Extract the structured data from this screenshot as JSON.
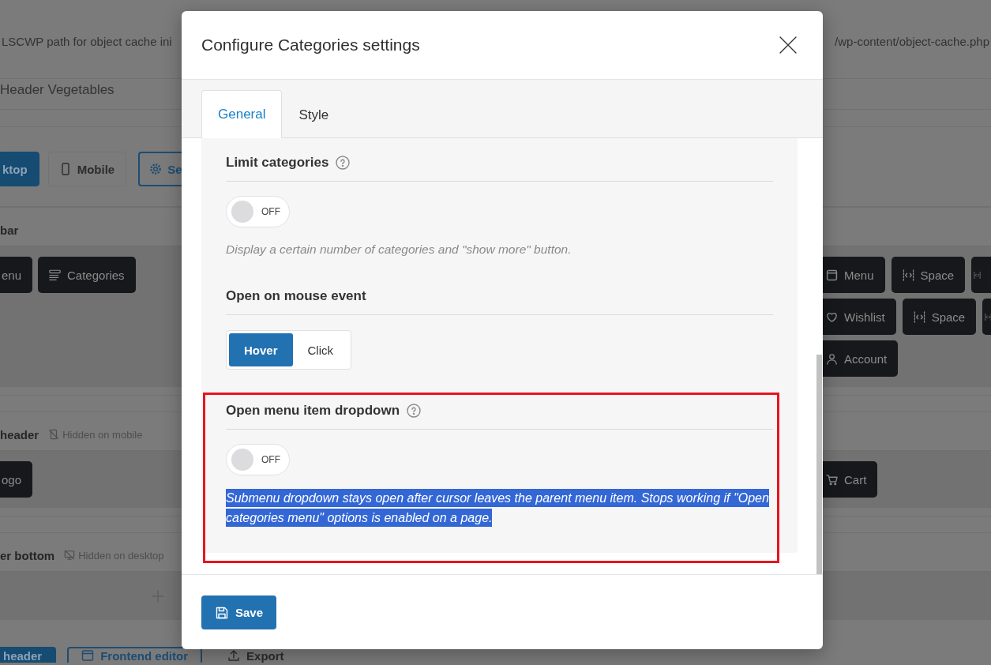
{
  "background": {
    "object_cache_row": {
      "label": "LSCWP path for object cache ini",
      "value": "/wp-content/object-cache.php"
    },
    "header_name": "Header Vegetables",
    "device_tabs": [
      {
        "label": "ktop",
        "selected": true
      },
      {
        "label": "Mobile",
        "selected": false,
        "kind": "mobile"
      }
    ],
    "settings_button": "Se",
    "builder_rows": [
      {
        "title": "bar",
        "left_elements": [
          {
            "label": "enu"
          },
          {
            "kind": "categories",
            "label": "Categories"
          }
        ],
        "right_groups": [
          {
            "elements": [
              {
                "kind": "menu",
                "label": "Menu"
              },
              {
                "kind": "space",
                "label": "Space"
              },
              {
                "kind": "space"
              }
            ]
          },
          {
            "elements": [
              {
                "kind": "wishlist",
                "label": "Wishlist"
              },
              {
                "kind": "space",
                "label": "Space"
              },
              {
                "kind": "space"
              }
            ]
          },
          {
            "elements": [
              {
                "kind": "account",
                "label": "Account"
              }
            ]
          }
        ]
      },
      {
        "title": "header",
        "visibility": {
          "kind": "mobile",
          "label": "Hidden on mobile"
        },
        "left_elements": [
          {
            "label": "ogo"
          }
        ],
        "right_groups": [
          {
            "elements": [
              {
                "kind": "cart",
                "label": "Cart"
              }
            ]
          }
        ]
      },
      {
        "title": "er bottom",
        "visibility": {
          "kind": "desktop",
          "label": "Hidden on desktop"
        },
        "add_button": true
      }
    ],
    "footer_buttons": [
      {
        "kind": "primary",
        "label": "header"
      },
      {
        "kind": "outline",
        "label": "Frontend editor"
      },
      {
        "kind": "plain",
        "label": "Export"
      }
    ]
  },
  "modal": {
    "title": "Configure Categories settings",
    "tabs": [
      {
        "label": "General",
        "selected": true
      },
      {
        "label": "Style",
        "selected": false
      }
    ],
    "settings": [
      {
        "kind": "toggle",
        "label": "Limit categories",
        "help": true,
        "on": false,
        "state_label": "OFF",
        "description": "Display a certain number of categories and \"show more\" button.",
        "text_selected": false,
        "highlighted": false
      },
      {
        "kind": "choice",
        "label": "Open on mouse event",
        "options": [
          {
            "label": "Hover",
            "selected": true
          },
          {
            "label": "Click",
            "selected": false
          }
        ],
        "highlighted": false
      },
      {
        "kind": "toggle",
        "label": "Open menu item dropdown",
        "help": true,
        "on": false,
        "state_label": "OFF",
        "description": "Submenu dropdown stays open after cursor leaves the parent menu item. Stops working if \"Open categories menu\" options is enabled on a page.",
        "text_selected": true,
        "highlighted": true
      }
    ],
    "save_button": "Save"
  }
}
